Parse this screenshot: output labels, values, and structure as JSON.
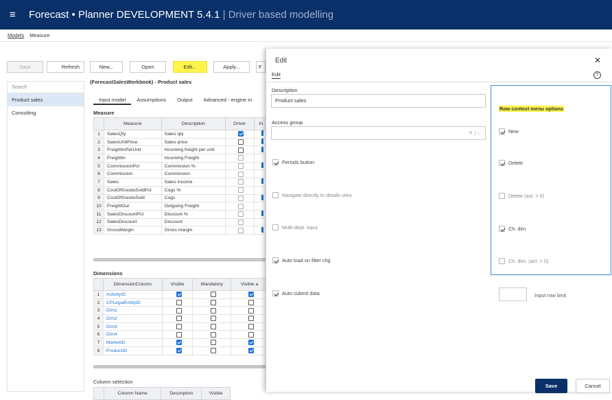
{
  "header": {
    "title": "Forecast • Planner DEVELOPMENT 5.4.1",
    "separator": "|",
    "subtitle": "Driver based modelling"
  },
  "topnav": [
    "Models",
    "Measure"
  ],
  "toolbar": {
    "save": "Save",
    "refresh": "Refresh",
    "new": "New...",
    "open": "Open",
    "edit": "Edit...",
    "apply": "Apply...",
    "truncated": "F"
  },
  "sidebar": {
    "search_placeholder": "Search",
    "items": [
      "Product sales",
      "Consulting"
    ]
  },
  "main": {
    "workbook_title": "(ForecastSalesWorkbook) - Product sales",
    "tabs": [
      "Input model",
      "Assumptions",
      "Output",
      "Advanced - engine in"
    ],
    "measure_label": "Measure",
    "measure_headers": [
      "",
      "Measure",
      "Description",
      "Driver",
      "In"
    ],
    "measures": [
      {
        "n": "1",
        "measure": "SalesQty",
        "desc": "Sales qty",
        "driver": true
      },
      {
        "n": "2",
        "measure": "SalesUnitPrice",
        "desc": "Sales price",
        "driver": false
      },
      {
        "n": "3",
        "measure": "FreightInPerUnit",
        "desc": "Incoming freight per unit",
        "driver": false
      },
      {
        "n": "4",
        "measure": "FreightIn",
        "desc": "Incoming Freight",
        "driver": false
      },
      {
        "n": "5",
        "measure": "CommissionPct",
        "desc": "Commission %",
        "driver": false
      },
      {
        "n": "6",
        "measure": "Commission",
        "desc": "Commission",
        "driver": false
      },
      {
        "n": "7",
        "measure": "Sales",
        "desc": "Sales income",
        "driver": false
      },
      {
        "n": "8",
        "measure": "CostOfGoodsSoldPct",
        "desc": "Cogs %",
        "driver": false
      },
      {
        "n": "9",
        "measure": "CostOfGoodsSold",
        "desc": "Cogs",
        "driver": false
      },
      {
        "n": "10",
        "measure": "FreightOut",
        "desc": "Outgoing Freight",
        "driver": false
      },
      {
        "n": "11",
        "measure": "SalesDiscountPct",
        "desc": "Discount %",
        "driver": false
      },
      {
        "n": "12",
        "measure": "SalesDiscount",
        "desc": "Discount",
        "driver": false
      },
      {
        "n": "13",
        "measure": "GrossMargin",
        "desc": "Gross margin",
        "driver": false
      }
    ],
    "dimensions_label": "Dimensions",
    "dimension_headers": [
      "",
      "DimensionColumn",
      "Visible",
      "Mandatory",
      "Visible a"
    ],
    "dimensions": [
      {
        "n": "1",
        "col": "ActivityID",
        "visible": true,
        "mandatory": false,
        "va": true
      },
      {
        "n": "2",
        "col": "CPLegalEntityID",
        "visible": false,
        "mandatory": false,
        "va": false
      },
      {
        "n": "3",
        "col": "Dim1",
        "visible": false,
        "mandatory": false,
        "va": false
      },
      {
        "n": "4",
        "col": "Dim2",
        "visible": false,
        "mandatory": false,
        "va": false
      },
      {
        "n": "5",
        "col": "Dim3",
        "visible": false,
        "mandatory": false,
        "va": false
      },
      {
        "n": "6",
        "col": "Dim4",
        "visible": false,
        "mandatory": false,
        "va": false
      },
      {
        "n": "7",
        "col": "MarketID",
        "visible": true,
        "mandatory": false,
        "va": true
      },
      {
        "n": "8",
        "col": "ProductID",
        "visible": true,
        "mandatory": false,
        "va": true
      }
    ],
    "column_selection_label": "Column selection",
    "column_selection_headers": [
      "",
      "Column Name",
      "Description",
      "Visible"
    ]
  },
  "dialog": {
    "title": "Edit",
    "close": "✕",
    "tab": "Edit",
    "help": "?",
    "description_label": "Description",
    "description_value": "Product sales",
    "access_group_label": "Access group",
    "access_group_controls": "✕ | ⌵",
    "left_options": [
      {
        "label": "Periods button",
        "checked": true
      },
      {
        "label": "Navigate directly to details view",
        "checked": false
      },
      {
        "label": "Multi-dept. input",
        "checked": false
      },
      {
        "label": "Auto load on filter chg",
        "checked": true
      },
      {
        "label": "Auto submit data",
        "checked": true
      }
    ],
    "row_context_title": "Row context menu options",
    "right_options": [
      {
        "label": "New",
        "checked": true
      },
      {
        "label": "Delete",
        "checked": true
      },
      {
        "label": "Delete (act. = 0)",
        "checked": false
      },
      {
        "label": "Ch. dim.",
        "checked": true
      },
      {
        "label": "Ch. dim. (act. = 0)",
        "checked": false
      }
    ],
    "input_row_limit_label": "Input row limit",
    "save": "Save",
    "cancel": "Cancel"
  },
  "colors": {
    "header": "#0a3069",
    "highlight": "#fff54a",
    "accent": "#1f73d6"
  }
}
